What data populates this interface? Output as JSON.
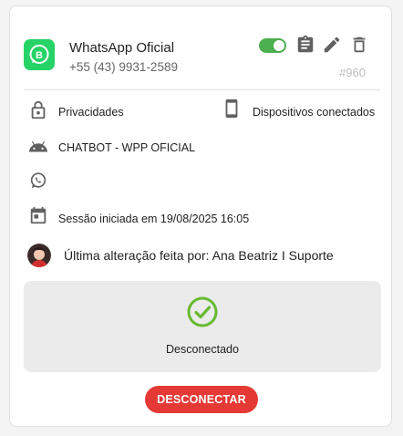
{
  "connection": {
    "name": "WhatsApp Oficial",
    "phone": "+55 (43) 9931-2589",
    "id_tag": "#960",
    "enabled": true
  },
  "details": {
    "privacy_label": "Privacidades",
    "devices_label": "Dispositivos conectados",
    "chatbot_label": "CHATBOT - WPP OFICIAL",
    "whatsapp_value": "",
    "session_label": "Sessão iniciada em 19/08/2025 16:05"
  },
  "last_change": {
    "text": "Última alteração feita por: Ana Beatriz I Suporte"
  },
  "status": {
    "label": "Desconectado"
  },
  "actions": {
    "disconnect_label": "DESCONECTAR"
  },
  "colors": {
    "accent_green": "#4caf50",
    "whatsapp_green": "#25d366",
    "danger_red": "#e53935",
    "icon_grey": "#616161"
  }
}
